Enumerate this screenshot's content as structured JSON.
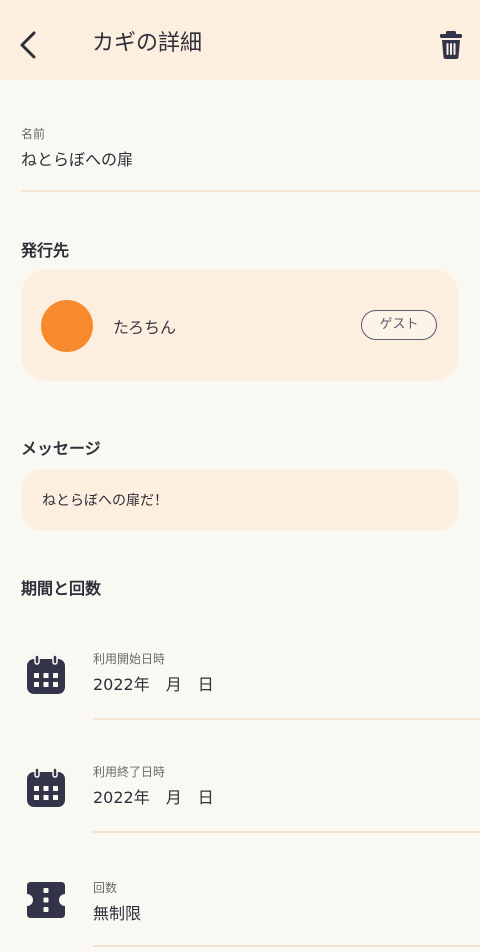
{
  "header": {
    "title": "カギの詳細"
  },
  "name_field": {
    "label": "名前",
    "value": "ねとらぼへの扉"
  },
  "recipient_section": {
    "title": "発行先",
    "name": "たろちん",
    "badge": "ゲスト",
    "avatar_color": "#f78a2c"
  },
  "message_section": {
    "title": "メッセージ",
    "text": "ねとらぼへの扉だ！"
  },
  "period_section": {
    "title": "期間と回数",
    "start": {
      "label": "利用開始日時",
      "value": "2022年　月　日"
    },
    "end": {
      "label": "利用終了日時",
      "value": "2022年　月　日"
    },
    "count": {
      "label": "回数",
      "value": "無制限"
    }
  },
  "colors": {
    "header_bg": "#fdefdf",
    "page_bg": "#faf8f3",
    "accent": "#f78a2c",
    "icon": "#33334a"
  },
  "icons": {
    "back": "chevron-left-icon",
    "delete": "trash-icon",
    "start_date": "calendar-icon",
    "end_date": "calendar-icon",
    "count": "ticket-icon"
  }
}
